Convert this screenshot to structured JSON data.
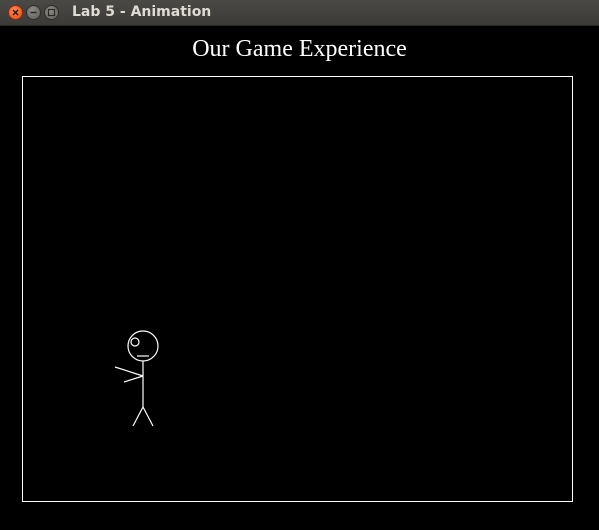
{
  "window": {
    "title": "Lab 5 - Animation",
    "controls": {
      "close_icon": "close-icon",
      "minimize_icon": "minimize-icon",
      "maximize_icon": "maximize-icon"
    }
  },
  "game": {
    "heading": "Our Game Experience",
    "background_color": "#000000",
    "line_color": "#ffffff",
    "character": "stick-figure"
  }
}
